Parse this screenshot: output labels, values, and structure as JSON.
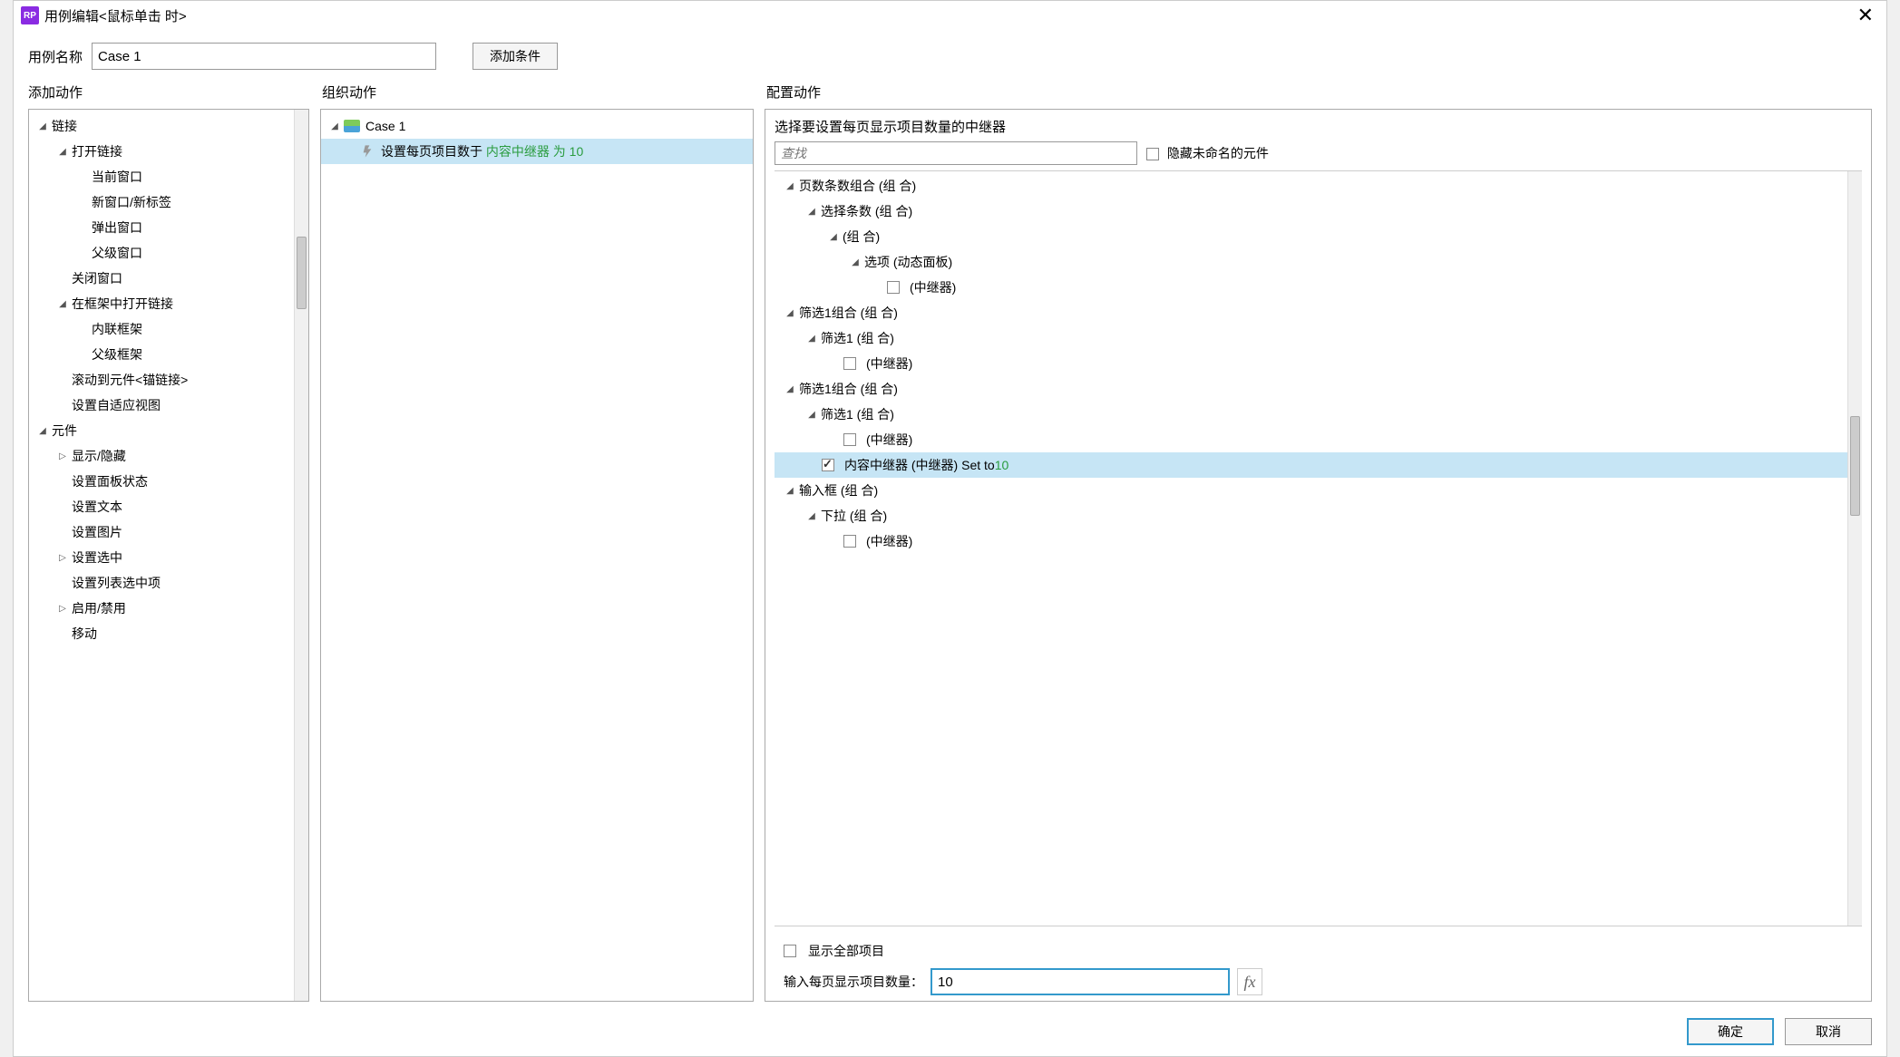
{
  "titlebar": {
    "app": "RP",
    "title": "用例编辑<鼠标单击 时>"
  },
  "top": {
    "case_name_label": "用例名称",
    "case_name_value": "Case 1",
    "add_condition": "添加条件"
  },
  "sections": {
    "left": "添加动作",
    "mid": "组织动作",
    "right": "配置动作"
  },
  "left_tree": [
    {
      "d": 0,
      "t": "exp",
      "label": "链接"
    },
    {
      "d": 1,
      "t": "exp",
      "label": "打开链接"
    },
    {
      "d": 2,
      "t": "leaf",
      "label": "当前窗口"
    },
    {
      "d": 2,
      "t": "leaf",
      "label": "新窗口/新标签"
    },
    {
      "d": 2,
      "t": "leaf",
      "label": "弹出窗口"
    },
    {
      "d": 2,
      "t": "leaf",
      "label": "父级窗口"
    },
    {
      "d": 1,
      "t": "leaf",
      "label": "关闭窗口"
    },
    {
      "d": 1,
      "t": "exp",
      "label": "在框架中打开链接"
    },
    {
      "d": 2,
      "t": "leaf",
      "label": "内联框架"
    },
    {
      "d": 2,
      "t": "leaf",
      "label": "父级框架"
    },
    {
      "d": 1,
      "t": "leaf",
      "label": "滚动到元件<锚链接>"
    },
    {
      "d": 1,
      "t": "leaf",
      "label": "设置自适应视图"
    },
    {
      "d": 0,
      "t": "exp",
      "label": "元件"
    },
    {
      "d": 1,
      "t": "col",
      "label": "显示/隐藏"
    },
    {
      "d": 1,
      "t": "leaf",
      "label": "设置面板状态"
    },
    {
      "d": 1,
      "t": "leaf",
      "label": "设置文本"
    },
    {
      "d": 1,
      "t": "leaf",
      "label": "设置图片"
    },
    {
      "d": 1,
      "t": "col",
      "label": "设置选中"
    },
    {
      "d": 1,
      "t": "leaf",
      "label": "设置列表选中项"
    },
    {
      "d": 1,
      "t": "col",
      "label": "启用/禁用"
    },
    {
      "d": 1,
      "t": "leaf",
      "label": "移动"
    }
  ],
  "mid_tree": {
    "case_label": "Case 1",
    "action_prefix": "设置每页项目数于 ",
    "action_target": "内容中继器 为 10"
  },
  "right": {
    "header": "选择要设置每页显示项目数量的中继器",
    "search_placeholder": "查找",
    "hide_unnamed": "隐藏未命名的元件",
    "tree": [
      {
        "d": 0,
        "t": "exp",
        "label": "页数条数组合 (组 合)"
      },
      {
        "d": 1,
        "t": "exp",
        "label": "选择条数 (组 合)"
      },
      {
        "d": 2,
        "t": "exp",
        "label": "(组 合)"
      },
      {
        "d": 3,
        "t": "exp",
        "label": "选项 (动态面板)"
      },
      {
        "d": 4,
        "t": "cb",
        "checked": false,
        "label": "(中继器)"
      },
      {
        "d": 0,
        "t": "exp",
        "label": "筛选1组合 (组 合)"
      },
      {
        "d": 1,
        "t": "exp",
        "label": "筛选1 (组 合)"
      },
      {
        "d": 2,
        "t": "cb",
        "checked": false,
        "label": "(中继器)"
      },
      {
        "d": 0,
        "t": "exp",
        "label": "筛选1组合 (组 合)"
      },
      {
        "d": 1,
        "t": "exp",
        "label": "筛选1 (组 合)"
      },
      {
        "d": 2,
        "t": "cb",
        "checked": false,
        "label": "(中继器)"
      },
      {
        "d": 1,
        "t": "cb",
        "checked": true,
        "selected": true,
        "label": "内容中继器 (中继器) Set to ",
        "suffix": "10"
      },
      {
        "d": 0,
        "t": "exp",
        "label": "输入框 (组 合)"
      },
      {
        "d": 1,
        "t": "exp",
        "label": "下拉 (组 合)"
      },
      {
        "d": 2,
        "t": "cb",
        "checked": false,
        "label": "(中继器)"
      }
    ],
    "show_all": "显示全部项目",
    "items_label": "输入每页显示项目数量：",
    "items_value": "10"
  },
  "footer": {
    "ok": "确定",
    "cancel": "取消"
  }
}
